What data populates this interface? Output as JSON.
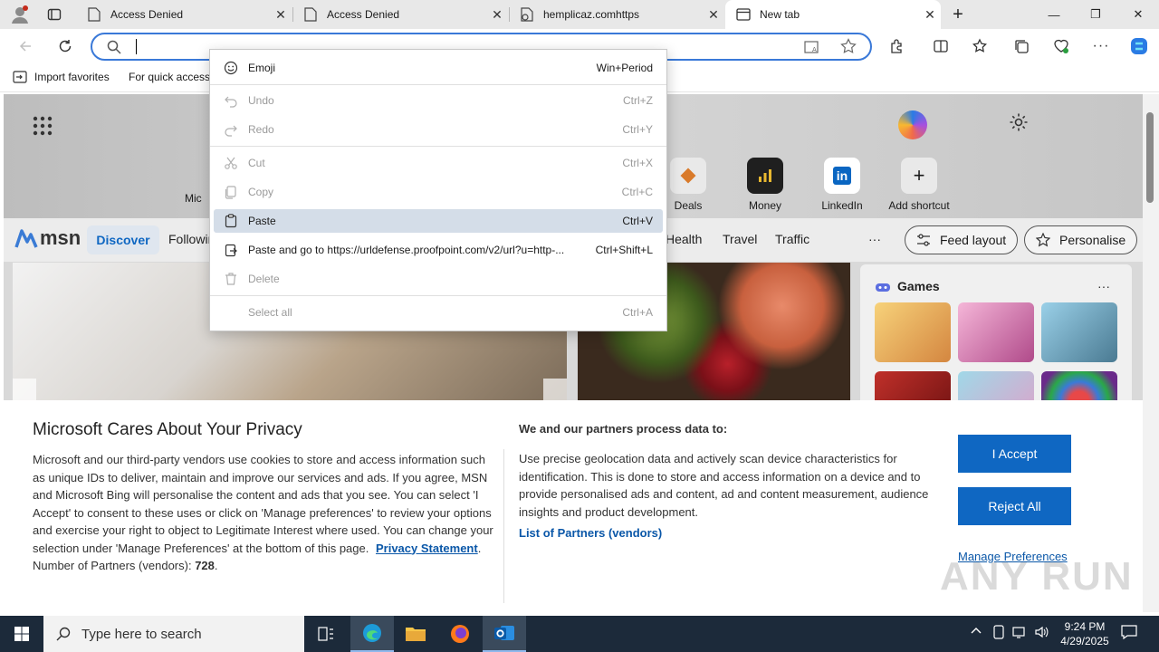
{
  "tabs": [
    {
      "label": "Access Denied",
      "close": "✕"
    },
    {
      "label": "Access Denied",
      "close": "✕"
    },
    {
      "label": "hemplicaz.comhttps",
      "close": "✕"
    },
    {
      "label": "New tab",
      "close": "✕"
    }
  ],
  "new_tab_glyph": "+",
  "window_controls": {
    "minimize": "—",
    "maximize": "❐",
    "close": "✕"
  },
  "favorites": {
    "import": "Import favorites",
    "quick": "For quick access,"
  },
  "shortcuts": [
    {
      "label": "Deals"
    },
    {
      "label": "Money"
    },
    {
      "label": "LinkedIn",
      "glyph": "in"
    },
    {
      "label": "Add shortcut",
      "glyph": "+"
    }
  ],
  "shortcut_partial": "Mic",
  "msn": {
    "logo": "msn",
    "nav": [
      "Discover",
      "Following",
      "Health",
      "Travel",
      "Traffic"
    ],
    "more": "···",
    "feed_layout": "Feed layout",
    "personalise": "Personalise",
    "games_title": "Games",
    "games_more": "···"
  },
  "context_menu": [
    {
      "label": "Emoji",
      "shortcut": "Win+Period",
      "icon": "emoji-icon",
      "disabled": false
    },
    {
      "label": "Undo",
      "shortcut": "Ctrl+Z",
      "icon": "undo-icon",
      "disabled": true
    },
    {
      "label": "Redo",
      "shortcut": "Ctrl+Y",
      "icon": "redo-icon",
      "disabled": true
    },
    {
      "label": "Cut",
      "shortcut": "Ctrl+X",
      "icon": "cut-icon",
      "disabled": true
    },
    {
      "label": "Copy",
      "shortcut": "Ctrl+C",
      "icon": "copy-icon",
      "disabled": true
    },
    {
      "label": "Paste",
      "shortcut": "Ctrl+V",
      "icon": "paste-icon",
      "disabled": false,
      "highlighted": true
    },
    {
      "label": "Paste and go to https://urldefense.proofpoint.com/v2/url?u=http-...",
      "shortcut": "Ctrl+Shift+L",
      "icon": "paste-go-icon",
      "disabled": false
    },
    {
      "label": "Delete",
      "shortcut": "",
      "icon": "delete-icon",
      "disabled": true
    },
    {
      "label": "Select all",
      "shortcut": "Ctrl+A",
      "icon": "",
      "disabled": true
    }
  ],
  "privacy": {
    "title": "Microsoft Cares About Your Privacy",
    "body": "Microsoft and our third-party vendors use cookies to store and access information such as unique IDs to deliver, maintain and improve our services and ads. If you agree, MSN and Microsoft Bing will personalise the content and ads that you see. You can select 'I Accept' to consent to these uses or click on 'Manage preferences' to review your options and exercise your right to object to Legitimate Interest where used.  You can change your selection under 'Manage Preferences' at the bottom of this page.",
    "privacy_link": "Privacy Statement",
    "partners_label": "Number of Partners (vendors):",
    "partners_count": "728",
    "purpose_title": "We and our partners process data to:",
    "purpose_text": "Use precise geolocation data and actively scan device characteristics for identification. This is done to store and access information on a device and to provide personalised ads and content, ad and content measurement, audience insights and product development.",
    "partners_link": "List of Partners (vendors)",
    "accept": "I Accept",
    "reject": "Reject All",
    "manage": "Manage Preferences"
  },
  "watermark": "ANY RUN",
  "taskbar": {
    "search_placeholder": "Type here to search",
    "time": "9:24 PM",
    "date": "4/29/2025"
  },
  "colors": {
    "accent": "#0f67c2",
    "address_border": "#3a79d8",
    "taskbar": "#1c2a3a"
  }
}
